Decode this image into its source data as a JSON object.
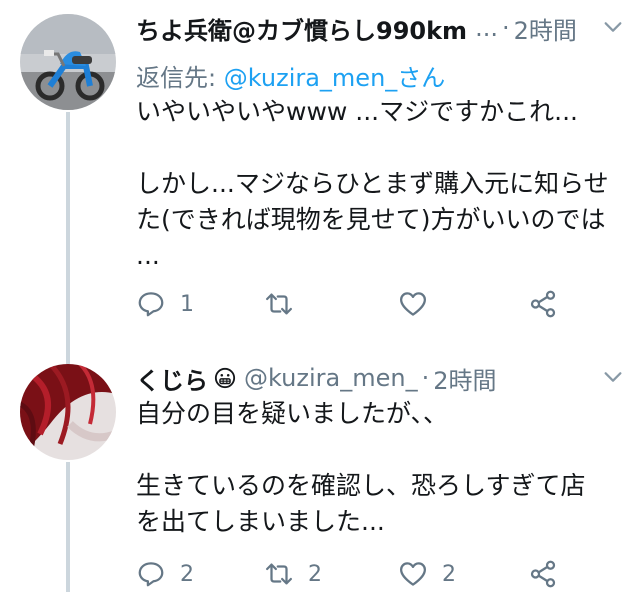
{
  "tweets": [
    {
      "display_name": "ちよ兵衛@カブ慣らし990km",
      "handle": "...",
      "separator": "·",
      "time": "2時間",
      "reply_to_label": "返信先: ",
      "reply_to_mention": "@kuzira_men_さん",
      "lines": [
        "いやいやいやwww ...マジですかこれ...",
        "",
        "しかし...マジならひとまず購入元に知らせ",
        "た(できれば現物を見せて)方がいいのでは",
        "..."
      ],
      "reply_count": "1",
      "retweet_count": "",
      "like_count": "",
      "avatar_icon": "motorbike-avatar",
      "colors": {
        "text": "#14171a",
        "muted": "#657786",
        "link": "#1da1f2",
        "thread": "#ccd6dd"
      }
    },
    {
      "display_name": "くじら",
      "handle": "@kuzira_men_",
      "separator": "·",
      "time": "2時間",
      "lines": [
        "自分の目を疑いましたが、、",
        "",
        "生きているのを確認し、恐ろしすぎて店",
        "を出てしまいました..."
      ],
      "reply_count": "2",
      "retweet_count": "2",
      "like_count": "2",
      "avatar_icon": "red-hair-avatar",
      "name_emoji": "grimacing-face-emoji"
    }
  ]
}
